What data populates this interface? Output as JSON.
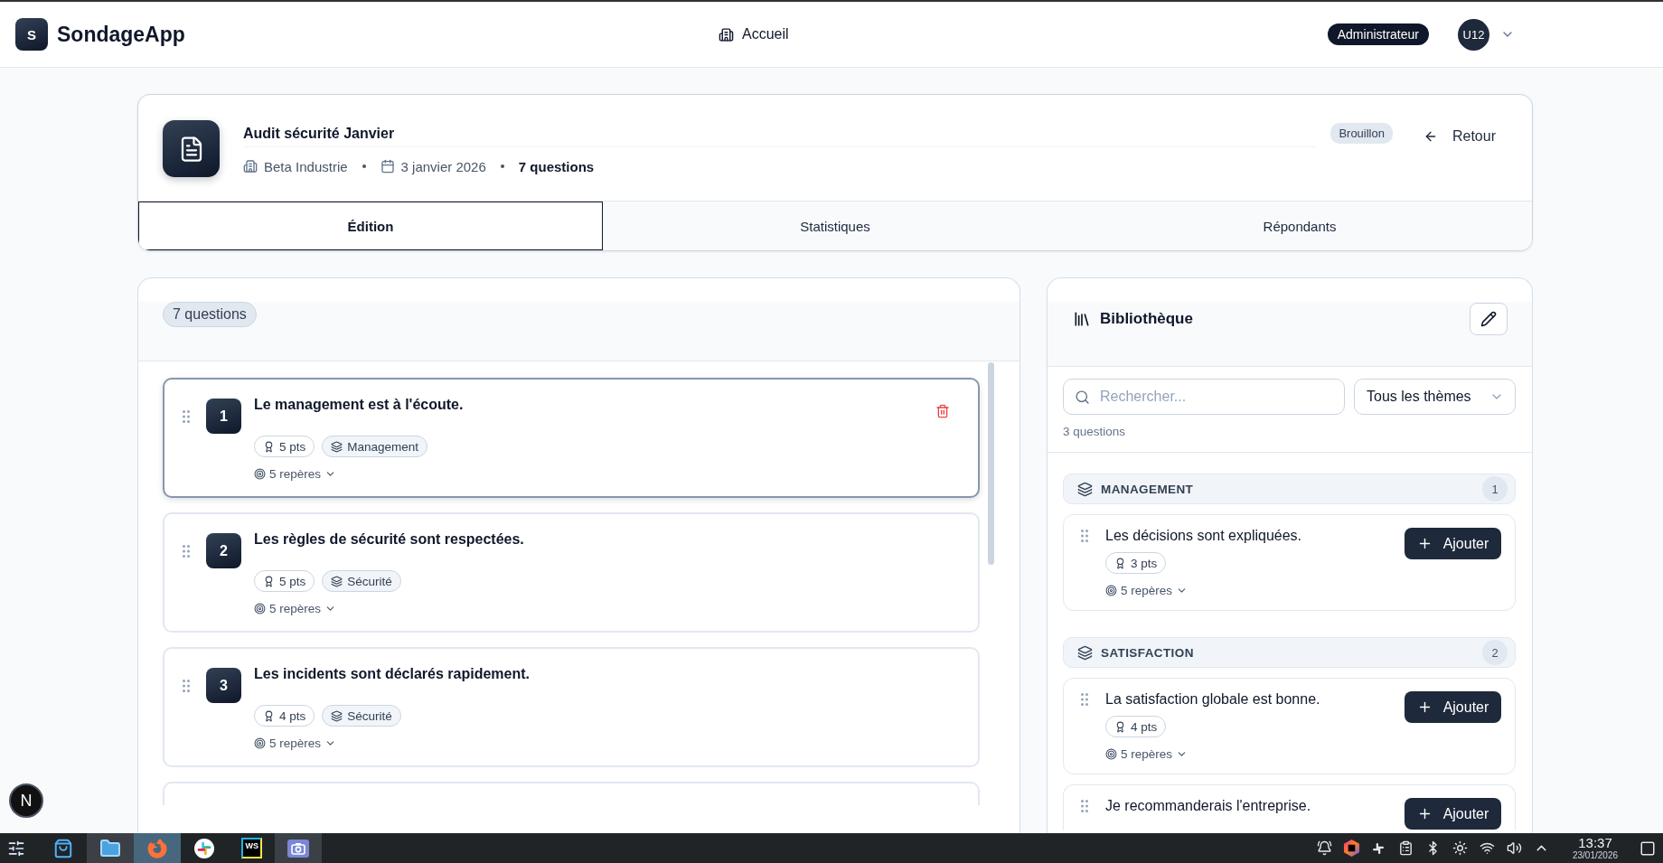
{
  "header": {
    "logo_letter": "S",
    "app_name": "SondageApp",
    "nav_link": "Accueil",
    "role_badge": "Administrateur",
    "avatar_initials": "U12"
  },
  "survey": {
    "title": "Audit sécurité Janvier",
    "company": "Beta Industrie",
    "date": "3 janvier 2026",
    "question_count": "7 questions",
    "status": "Brouillon",
    "back_label": "Retour"
  },
  "tabs": [
    {
      "label": "Édition",
      "selected": true
    },
    {
      "label": "Statistiques",
      "selected": false
    },
    {
      "label": "Répondants",
      "selected": false
    }
  ],
  "questions_panel": {
    "count_badge": "7 questions",
    "questions": [
      {
        "kind": "question",
        "number": "1",
        "text": "Le management est à l'écoute.",
        "points": "5 pts",
        "theme": "Management",
        "benchmarks": "5 repères",
        "selected": true
      },
      {
        "kind": "question",
        "number": "2",
        "text": "Les règles de sécurité sont respectées.",
        "points": "5 pts",
        "theme": "Sécurité",
        "benchmarks": "5 repères",
        "selected": false
      },
      {
        "kind": "question",
        "number": "3",
        "text": "Les incidents sont déclarés rapidement.",
        "points": "4 pts",
        "theme": "Sécurité",
        "benchmarks": "5 repères",
        "selected": false
      },
      {
        "kind": "clipped",
        "selected": false
      }
    ]
  },
  "library": {
    "title": "Bibliothèque",
    "search": {
      "placeholder": "Rechercher..."
    },
    "theme_filter": "Tous les thèmes",
    "result_count": "3 questions",
    "groups": [
      {
        "name": "MANAGEMENT",
        "count": "1",
        "questions": [
          {
            "kind": "full",
            "text": "Les décisions sont expliquées.",
            "points": "3 pts",
            "benchmarks": "5 repères",
            "add_label": "Ajouter"
          }
        ]
      },
      {
        "name": "SATISFACTION",
        "count": "2",
        "questions": [
          {
            "kind": "full",
            "text": "La satisfaction globale est bonne.",
            "points": "4 pts",
            "benchmarks": "5 repères",
            "add_label": "Ajouter"
          },
          {
            "kind": "clipped",
            "text": "Je recommanderais l'entreprise.",
            "add_label": "Ajouter"
          }
        ]
      }
    ]
  },
  "dev_badge": "N",
  "taskbar": {
    "apps": [
      {
        "kind": "launcher",
        "running": false,
        "active": false
      },
      {
        "kind": "store",
        "running": false,
        "active": false
      },
      {
        "kind": "files",
        "running": true,
        "active": false
      },
      {
        "kind": "browser",
        "running": true,
        "active": true
      },
      {
        "kind": "chat",
        "running": false,
        "active": false
      },
      {
        "kind": "ide",
        "label": "WS",
        "running": false,
        "active": false
      },
      {
        "kind": "screenshot",
        "running": true,
        "active": false
      }
    ],
    "clock": {
      "time": "13:37",
      "date": "23/01/2026"
    }
  }
}
